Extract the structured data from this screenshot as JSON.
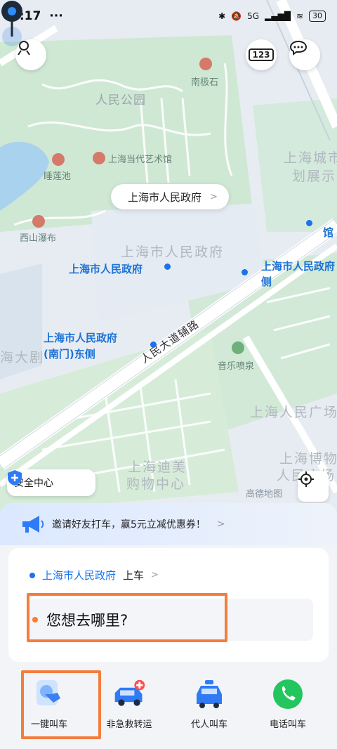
{
  "status": {
    "time": "4:17",
    "dots": "···",
    "network": "5G",
    "battery": "30"
  },
  "map": {
    "poi_labels": [
      {
        "text": "人民公园"
      },
      {
        "text": "南极石"
      },
      {
        "text": "睡莲池"
      },
      {
        "text": "上海当代艺术馆"
      },
      {
        "text": "西山瀑布"
      },
      {
        "text": "上海城市"
      },
      {
        "text": "划展示"
      },
      {
        "text": "上海市人民政府"
      },
      {
        "text": "海大剧"
      },
      {
        "text": "人民大道辅路"
      },
      {
        "text": "音乐喷泉"
      },
      {
        "text": "上海人民广场"
      },
      {
        "text": "上海迪美"
      },
      {
        "text": "购物中心"
      },
      {
        "text": "上海博物"
      },
      {
        "text": "人民广场"
      }
    ],
    "stop_labels": [
      {
        "text": "上海市人民政府"
      },
      {
        "text": "上海市人民政府"
      },
      {
        "text": "侧"
      },
      {
        "text": "上海市人民政府"
      },
      {
        "text": "(南门)东侧"
      },
      {
        "text": "馆"
      }
    ],
    "pickup_bubble": "上海市人民政府",
    "bubble_chevron": ">",
    "safety_center": "安全中心",
    "amap_logo": "高德地图",
    "traffic_badge": "123"
  },
  "sheet": {
    "promo_text": "邀请好友打车，赢5元立减优惠券！",
    "promo_chevron": ">",
    "pickup_place": "上海市人民政府",
    "pickup_suffix": "上车",
    "pickup_chevron": ">",
    "destination_placeholder": "您想去哪里?",
    "services": [
      {
        "label": "一键叫车",
        "icon": "one-tap-hand-icon"
      },
      {
        "label": "非急救转运",
        "icon": "ambulance-icon"
      },
      {
        "label": "代人叫车",
        "icon": "taxi-icon"
      },
      {
        "label": "电话叫车",
        "icon": "phone-icon"
      }
    ]
  },
  "colors": {
    "accent_blue": "#1a73e8",
    "highlight_orange": "#f47d3d",
    "park_green": "#cfe8d4"
  }
}
